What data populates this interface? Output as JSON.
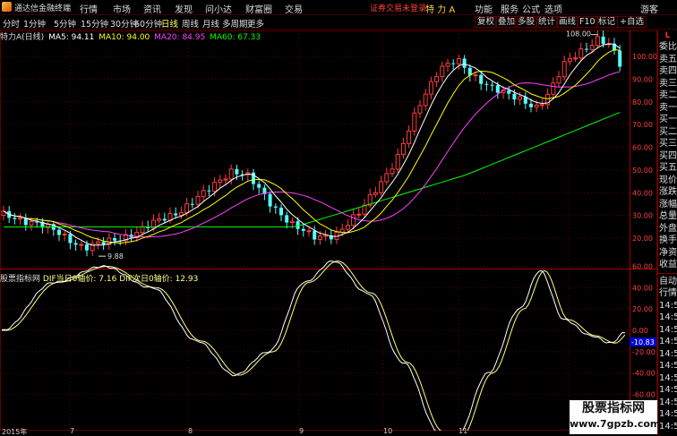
{
  "app": {
    "title": "通达信金融终端"
  },
  "menu": [
    "行情",
    "市场",
    "资讯",
    "发现",
    "问小达",
    "财富圈",
    "交易"
  ],
  "status": {
    "text": "证券交易未登录",
    "stock": "特 力 A"
  },
  "window_buttons": [
    "功能",
    "服务",
    "公式",
    "选项",
    "游客"
  ],
  "periods": [
    "分时",
    "1分钟",
    "5分钟",
    "15分钟",
    "30分钟",
    "60分钟",
    "日线",
    "周线",
    "月线",
    "多周期",
    "更多"
  ],
  "active_period": "日线",
  "tool_buttons": [
    "复权",
    "叠加",
    "多股",
    "统计",
    "画线",
    "F10",
    "标记",
    "+自选"
  ],
  "main_header": {
    "stock_label": "特力A(日线)",
    "ma5": "MA5: 94.11",
    "ma10": "MA10: 94.00",
    "ma20": "MA20: 84.95",
    "ma60": "MA60: 67.33"
  },
  "indicator_header": {
    "name": "股票指标网",
    "dif1": "DIF当日0轴价: 7.16",
    "dif2": "DIF次日0轴价: 12.93"
  },
  "price_axis": {
    "labels": [
      "100.00",
      "90.00",
      "80.00",
      "70.00",
      "60.00",
      "50.00",
      "40.00",
      "30.00",
      "20.00"
    ],
    "values": [
      100,
      90,
      80,
      70,
      60,
      50,
      40,
      30,
      20
    ]
  },
  "indicator_axis": {
    "labels": [
      "60.00",
      "40.00",
      "20.00",
      "0.00",
      "-20.00",
      "-40.00",
      "-60.00"
    ],
    "values": [
      60,
      40,
      20,
      0,
      -20,
      -40,
      -60
    ],
    "current_label": "-10.83"
  },
  "annotations": {
    "high": "108.00",
    "low": "9.88"
  },
  "date_axis": [
    "2015年",
    "7",
    "8",
    "9",
    "10",
    "11",
    "12"
  ],
  "right_panel": {
    "header": "L",
    "items_top": [
      "委比",
      "卖五",
      "卖四",
      "卖三",
      "卖二",
      "卖一",
      "买一",
      "买二",
      "买三",
      "买四",
      "买五",
      "现价",
      "涨跌",
      "涨幅",
      "总量",
      "外盘",
      "换手",
      "净资",
      "收益"
    ],
    "items_bottom": [
      "自动",
      "行情",
      "14:56",
      "14:56",
      "14:56",
      "14:56",
      "14:56",
      "14:56",
      "14:56",
      "14:56",
      "14:56",
      "14:56",
      "14:56"
    ]
  },
  "watermark": {
    "line1": "股票指标网",
    "line2": "www.7gpzb.com"
  },
  "colors": {
    "up": "#ff3c3c",
    "down": "#54ffff",
    "ma5": "#ffffff",
    "ma10": "#ffff00",
    "ma20": "#ff40ff",
    "ma60": "#00ff00",
    "grid": "#5a0000"
  }
}
